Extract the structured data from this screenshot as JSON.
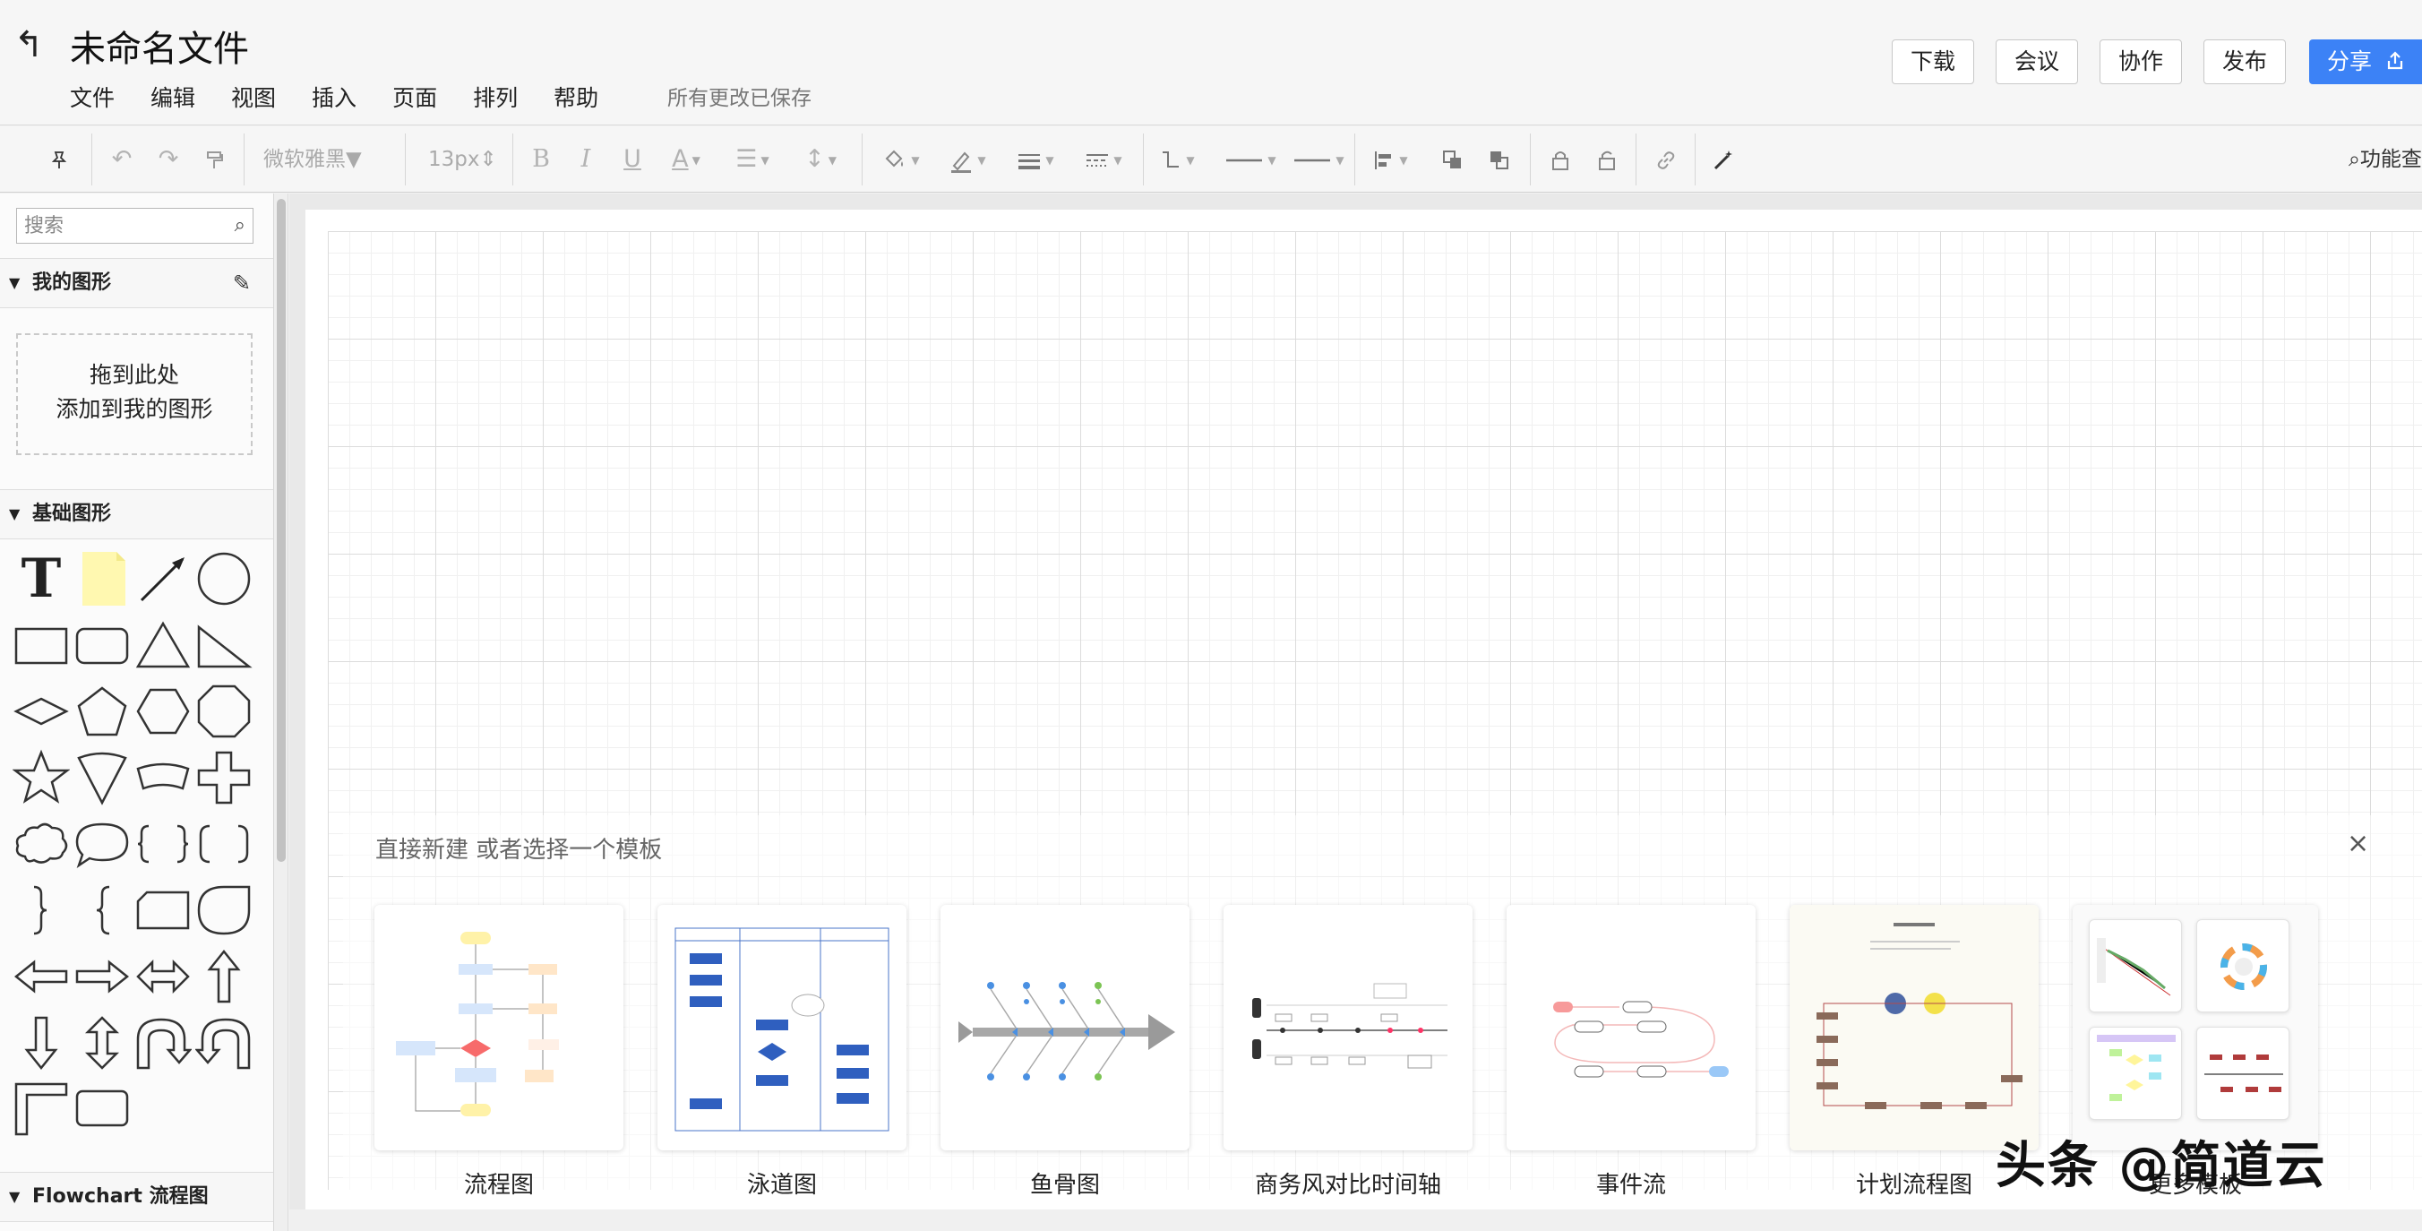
{
  "header": {
    "back_icon": "undo-arrow-icon",
    "title": "未命名文件",
    "menu": [
      "文件",
      "编辑",
      "视图",
      "插入",
      "页面",
      "排列",
      "帮助"
    ],
    "save_status": "所有更改已保存",
    "buttons": {
      "download": "下载",
      "meeting": "会议",
      "collaborate": "协作",
      "publish": "发布",
      "share": "分享"
    }
  },
  "toolbar": {
    "font_family": "微软雅黑",
    "font_size": "13px",
    "search_label": "功能查",
    "icons": [
      "pin-icon",
      "undo-icon",
      "redo-icon",
      "format-painter-icon",
      "bold-icon",
      "italic-icon",
      "underline-icon",
      "font-color-icon",
      "align-icon",
      "line-spacing-icon",
      "fill-color-icon",
      "line-color-icon",
      "line-width-icon",
      "line-dash-icon",
      "connector-icon",
      "line-start-icon",
      "line-end-icon",
      "align-objects-icon",
      "bring-front-icon",
      "send-back-icon",
      "lock-icon",
      "unlock-icon",
      "link-icon",
      "magic-wand-icon"
    ]
  },
  "sidebar": {
    "search_placeholder": "搜索",
    "my_shapes": "我的图形",
    "drop_line1": "拖到此处",
    "drop_line2": "添加到我的图形",
    "basic_shapes": "基础图形",
    "flowchart": "Flowchart 流程图",
    "shape_text_glyph": "T"
  },
  "canvas": {
    "prompt": "直接新建 或者选择一个模板",
    "close_glyph": "×",
    "templates": [
      "流程图",
      "泳道图",
      "鱼骨图",
      "商务风对比时间轴",
      "事件流",
      "计划流程图",
      "更多模板"
    ]
  },
  "watermark": "头条 @简道云",
  "colors": {
    "accent": "#3c82f6",
    "grid": "#dcdcdc",
    "note": "#fff8b0"
  }
}
